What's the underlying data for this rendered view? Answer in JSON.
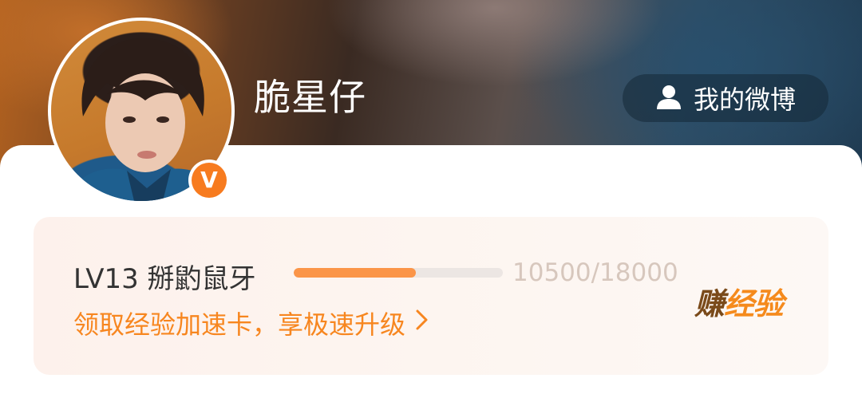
{
  "profile": {
    "username": "脆星仔",
    "verified_badge": "V",
    "my_weibo_label": "我的微博",
    "my_weibo_icon": "user-icon"
  },
  "level_card": {
    "level_text": "LV13 掰䶂鼠牙",
    "exp_current": 10500,
    "exp_total": 18000,
    "exp_text": "10500/18000",
    "progress_fraction": 0.583,
    "promo_text": "领取经验加速卡，享极速升级",
    "promo_icon": "chevron-right-icon",
    "earn_label_part1": "赚",
    "earn_label_part2": "经验"
  },
  "colors": {
    "accent_orange": "#f77b1f",
    "progress_fill": "#fb9548",
    "progress_track": "#ece6e3",
    "earn_dark": "#7a4a1a"
  }
}
